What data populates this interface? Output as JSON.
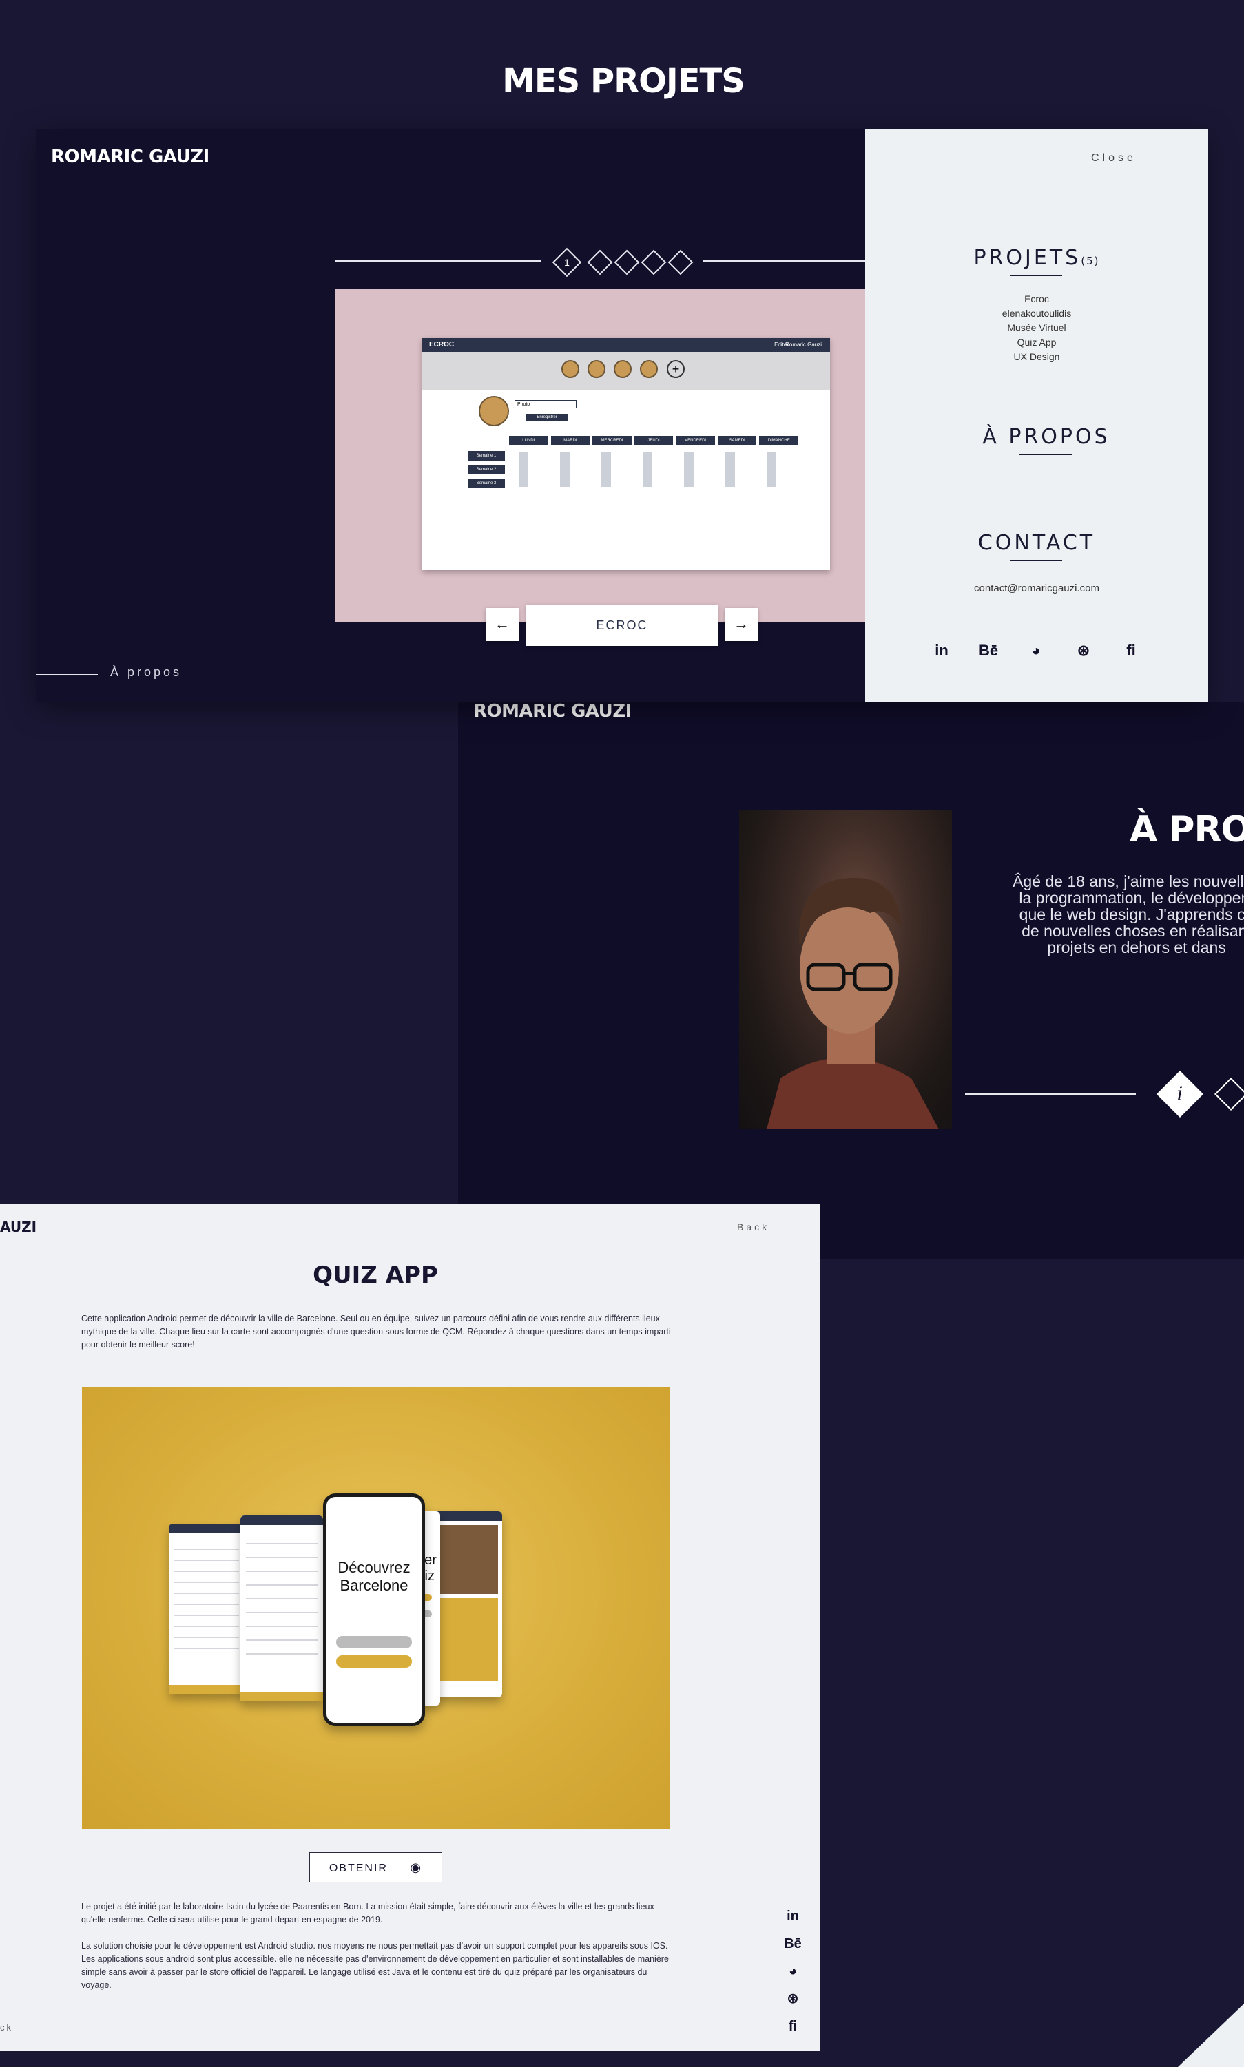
{
  "projects_panel": {
    "brand": "ROMARIC GAUZI",
    "title": "MES PROJETS",
    "current_index": "1",
    "carousel_count": 5,
    "current_project": "ECROC",
    "prev_icon": "arrow-left-icon",
    "next_icon": "arrow-right-icon",
    "about_link": "À propos",
    "mockup": {
      "app_name": "ECROC",
      "top_links": [
        "Editer",
        "Romaric Gauzi"
      ],
      "input_value": "Photo",
      "save_button": "Enregistrer",
      "days": [
        "LUNDI",
        "MARDI",
        "MERCREDI",
        "JEUDI",
        "VENDREDI",
        "SAMEDI",
        "DIMANCHE"
      ],
      "rows": [
        "Semaine 1",
        "Semaine 2",
        "Semaine 3"
      ]
    }
  },
  "menu": {
    "close_label": "Close",
    "projects_heading": "PROJETS",
    "projects_count": "(5)",
    "projects": [
      "Ecroc",
      "elenakoutoulidis",
      "Musée Virtuel",
      "Quiz App",
      "UX Design"
    ],
    "about_heading": "À PROPOS",
    "contact_heading": "CONTACT",
    "email": "contact@romaricgauzi.com",
    "socials": [
      {
        "icon": "linkedin-icon",
        "glyph": "in"
      },
      {
        "icon": "behance-icon",
        "glyph": "Bē"
      },
      {
        "icon": "github-icon",
        "glyph": "◕"
      },
      {
        "icon": "dribbble-icon",
        "glyph": "⊛"
      },
      {
        "icon": "fi-icon",
        "glyph": "fi"
      }
    ]
  },
  "about_panel": {
    "brand": "ROMARIC GAUZI",
    "title": "À PROPOS",
    "text": "Âgé de 18 ans, j'aime les nouvelles\nla programmation, le développem\nque le web design. J'apprends co\nde nouvelles choses en réalisant\nprojets en dehors et dans",
    "info_icon": "info-icon"
  },
  "quiz_panel": {
    "brand": "AUZI",
    "back_label": "Back",
    "title": "QUIZ APP",
    "intro": "Cette application Android permet de découvrir la ville de Barcelone. Seul ou en équipe, suivez un parcours défini afin de vous rendre aux différents lieux mythique de la ville. Chaque lieu sur la carte sont accompagnés d'une question sous forme de QCM. Répondez à chaque questions dans un temps imparti pour obtenir le meilleur score!",
    "phone_text_1": "Découvrez Barcelone",
    "phone_text_2": "Commencer le Quiz",
    "obtain_label": "OBTENIR",
    "obtain_icon": "eye-icon",
    "para1": "Le projet a été initié par le laboratoire Iscin du lycée de Paarentis en Born. La mission était simple, faire découvrir aux élèves la ville et les grands lieux qu'elle renferme. Celle ci sera utilise pour le grand depart en espagne de 2019.",
    "para2": "La solution choisie pour le développement est Android studio. nos moyens ne nous permettait pas d'avoir un support complet pour les appareils sous IOS. Les applications sous android sont plus accessible. elle ne nécessite pas d'environnement de développement en particulier et sont installables de manière simple sans avoir à passer par le store officiel de l'appareil. Le langage utilisé est Java et le contenu est tiré du quiz préparé par les organisateurs du voyage.",
    "bottom_left": "ck"
  }
}
